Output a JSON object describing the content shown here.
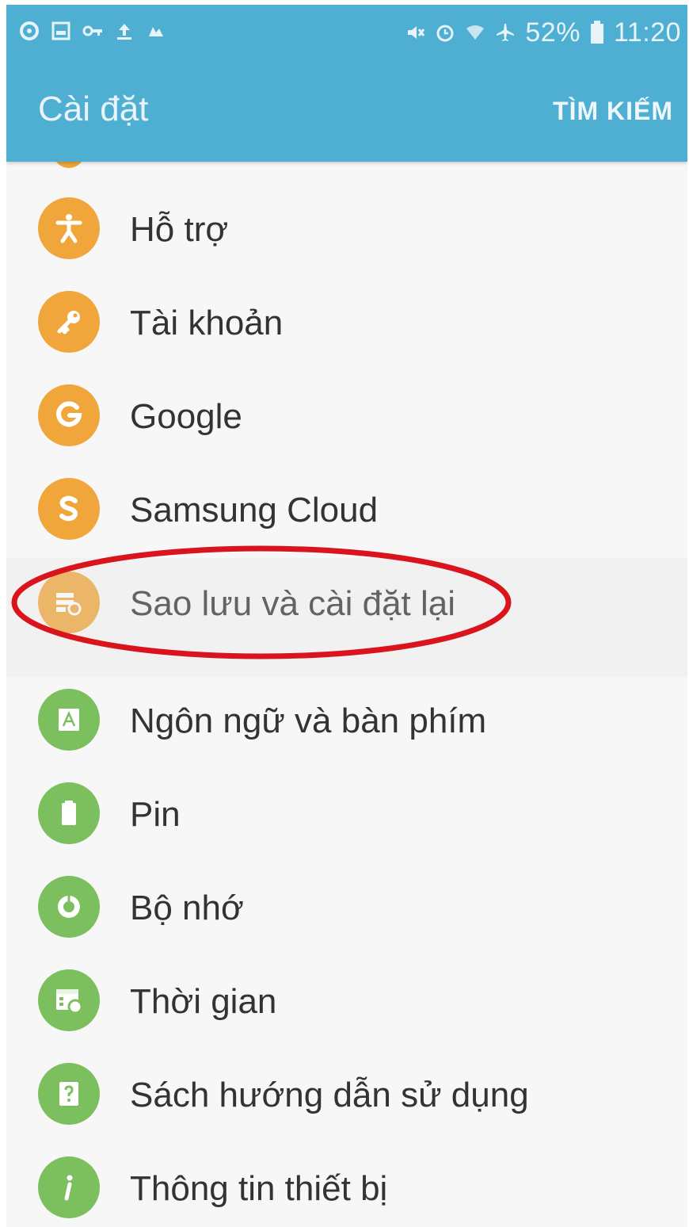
{
  "status_bar": {
    "left_icons": [
      "settings-icon",
      "image-icon",
      "key-icon",
      "upload-icon",
      "cloud-icon"
    ],
    "right_icons": [
      "mute-icon",
      "alarm-icon",
      "wifi-icon",
      "airplane-icon"
    ],
    "battery": "52%",
    "time": "11:20"
  },
  "app_bar": {
    "title": "Cài đặt",
    "search_label": "TÌM KIẾM"
  },
  "settings": {
    "items": [
      {
        "label": "Hỗ trợ",
        "icon": "accessibility-icon",
        "color": "#f0a63b"
      },
      {
        "label": "Tài khoản",
        "icon": "key-icon",
        "color": "#f0a63b"
      },
      {
        "label": "Google",
        "icon": "google-icon",
        "color": "#f0a63b"
      },
      {
        "label": "Samsung Cloud",
        "icon": "samsung-cloud-icon",
        "color": "#f0a63b"
      },
      {
        "label": "Sao lưu và cài đặt lại",
        "icon": "backup-reset-icon",
        "color": "#f0a63b"
      },
      {
        "label": "Ngôn ngữ và bàn phím",
        "icon": "language-icon",
        "color": "#7cbf5e"
      },
      {
        "label": "Pin",
        "icon": "battery-icon",
        "color": "#7cbf5e"
      },
      {
        "label": "Bộ nhớ",
        "icon": "storage-icon",
        "color": "#7cbf5e"
      },
      {
        "label": "Thời gian",
        "icon": "date-time-icon",
        "color": "#7cbf5e"
      },
      {
        "label": "Sách hướng dẫn sử dụng",
        "icon": "user-manual-icon",
        "color": "#7cbf5e"
      },
      {
        "label": "Thông tin thiết bị",
        "icon": "info-icon",
        "color": "#7cbf5e"
      }
    ]
  },
  "colors": {
    "app_bar": "#4fafd2",
    "highlight_ring": "#d9141c"
  }
}
